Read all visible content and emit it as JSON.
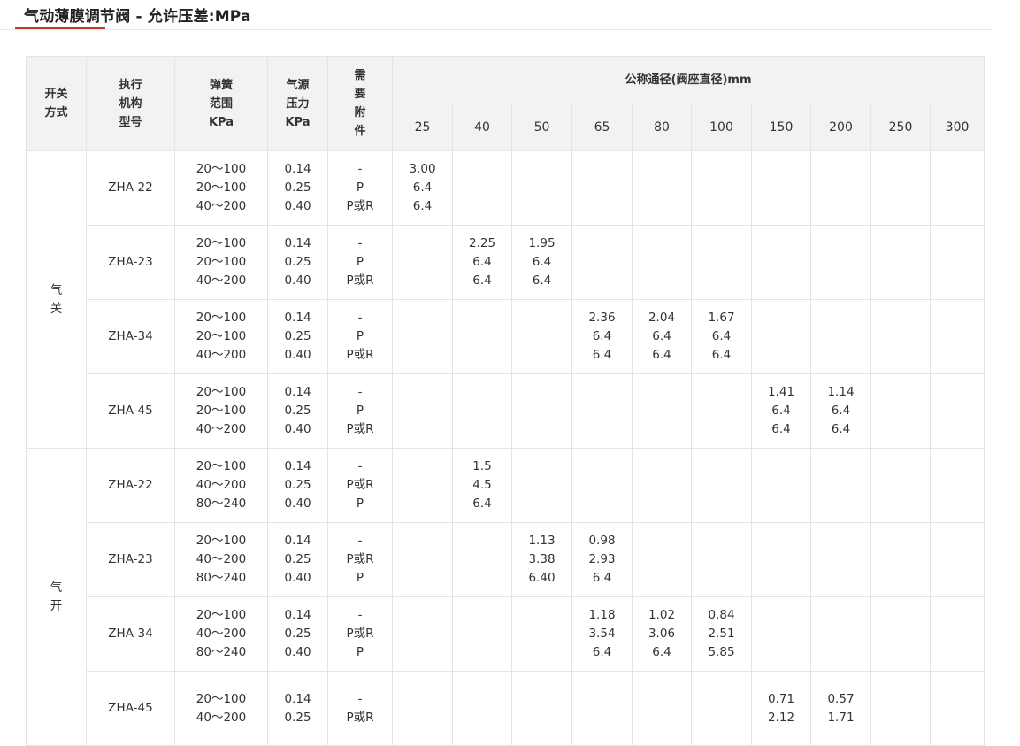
{
  "page": {
    "title": "气动薄膜调节阀 - 允许压差:MPa",
    "accent_color": "#c0392b"
  },
  "table": {
    "headers": {
      "mode": [
        "开关",
        "方式"
      ],
      "model": [
        "执行",
        "机构",
        "型号"
      ],
      "spring": [
        "弹簧",
        "范围",
        "KPa"
      ],
      "air": [
        "气源",
        "压力",
        "KPa"
      ],
      "accessory": [
        "需",
        "要",
        "附",
        "件"
      ],
      "nominal": "公称通径(阀座直径)mm",
      "sizes": [
        "25",
        "40",
        "50",
        "65",
        "80",
        "100",
        "150",
        "200",
        "250",
        "300"
      ]
    },
    "groups": [
      {
        "mode": [
          "气",
          "关"
        ],
        "rows": [
          {
            "model": "ZHA-22",
            "spring": [
              "20～100",
              "20～100",
              "40～200"
            ],
            "air": [
              "0.14",
              "0.25",
              "0.40"
            ],
            "acc": [
              "-",
              "P",
              "P或R"
            ],
            "values": [
              [
                "3.00",
                "6.4",
                "6.4"
              ],
              [],
              [],
              [],
              [],
              [],
              [],
              [],
              [],
              []
            ]
          },
          {
            "model": "ZHA-23",
            "spring": [
              "20～100",
              "20～100",
              "40～200"
            ],
            "air": [
              "0.14",
              "0.25",
              "0.40"
            ],
            "acc": [
              "-",
              "P",
              "P或R"
            ],
            "values": [
              [],
              [
                "2.25",
                "6.4",
                "6.4"
              ],
              [
                "1.95",
                "6.4",
                "6.4"
              ],
              [],
              [],
              [],
              [],
              [],
              [],
              []
            ]
          },
          {
            "model": "ZHA-34",
            "spring": [
              "20～100",
              "20～100",
              "40～200"
            ],
            "air": [
              "0.14",
              "0.25",
              "0.40"
            ],
            "acc": [
              "-",
              "P",
              "P或R"
            ],
            "values": [
              [],
              [],
              [],
              [
                "2.36",
                "6.4",
                "6.4"
              ],
              [
                "2.04",
                "6.4",
                "6.4"
              ],
              [
                "1.67",
                "6.4",
                "6.4"
              ],
              [],
              [],
              [],
              []
            ]
          },
          {
            "model": "ZHA-45",
            "spring": [
              "20～100",
              "20～100",
              "40～200"
            ],
            "air": [
              "0.14",
              "0.25",
              "0.40"
            ],
            "acc": [
              "-",
              "P",
              "P或R"
            ],
            "values": [
              [],
              [],
              [],
              [],
              [],
              [],
              [
                "1.41",
                "6.4",
                "6.4"
              ],
              [
                "1.14",
                "6.4",
                "6.4"
              ],
              [],
              []
            ]
          }
        ]
      },
      {
        "mode": [
          "气",
          "开"
        ],
        "rows": [
          {
            "model": "ZHA-22",
            "spring": [
              "20～100",
              "40～200",
              "80～240"
            ],
            "air": [
              "0.14",
              "0.25",
              "0.40"
            ],
            "acc": [
              "-",
              "P或R",
              "P"
            ],
            "values": [
              [],
              [
                "1.5",
                "4.5",
                "6.4"
              ],
              [],
              [],
              [],
              [],
              [],
              [],
              [],
              []
            ]
          },
          {
            "model": "ZHA-23",
            "spring": [
              "20～100",
              "40～200",
              "80～240"
            ],
            "air": [
              "0.14",
              "0.25",
              "0.40"
            ],
            "acc": [
              "-",
              "P或R",
              "P"
            ],
            "values": [
              [],
              [],
              [
                "1.13",
                "3.38",
                "6.40"
              ],
              [
                "0.98",
                "2.93",
                "6.4"
              ],
              [],
              [],
              [],
              [],
              [],
              []
            ]
          },
          {
            "model": "ZHA-34",
            "spring": [
              "20～100",
              "40～200",
              "80～240"
            ],
            "air": [
              "0.14",
              "0.25",
              "0.40"
            ],
            "acc": [
              "-",
              "P或R",
              "P"
            ],
            "values": [
              [],
              [],
              [],
              [
                "1.18",
                "3.54",
                "6.4"
              ],
              [
                "1.02",
                "3.06",
                "6.4"
              ],
              [
                "0.84",
                "2.51",
                "5.85"
              ],
              [],
              [],
              [],
              []
            ]
          },
          {
            "model": "ZHA-45",
            "spring": [
              "20～100",
              "40～200"
            ],
            "air": [
              "0.14",
              "0.25"
            ],
            "acc": [
              "-",
              "P或R"
            ],
            "values": [
              [],
              [],
              [],
              [],
              [],
              [],
              [
                "0.71",
                "2.12"
              ],
              [
                "0.57",
                "1.71"
              ],
              [],
              []
            ]
          }
        ]
      }
    ]
  }
}
